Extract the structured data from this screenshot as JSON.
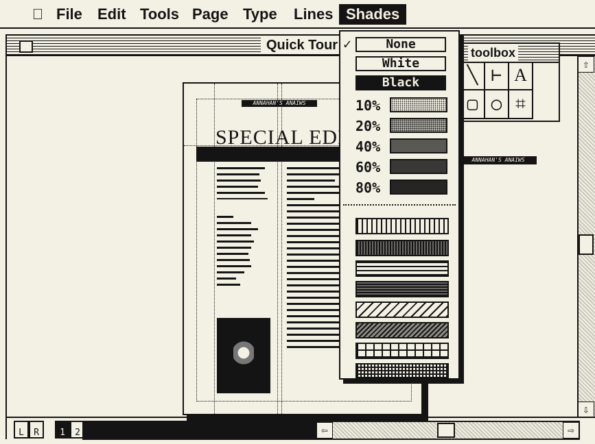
{
  "menubar": {
    "apple": "",
    "items": [
      "File",
      "Edit",
      "Tools",
      "Page",
      "Type",
      "Lines",
      "Shades"
    ]
  },
  "window": {
    "title": "Quick Tour"
  },
  "document": {
    "masthead": "ANNAHAN'S ANAIWS",
    "title": "SPECIAL EDIT",
    "side_strip": "ANNAHAN'S ANAIWS"
  },
  "toolbox": {
    "title": "toolbox",
    "tools": [
      "╲",
      "⊢",
      "A",
      "▢",
      "○",
      "⌗"
    ]
  },
  "shades_menu": {
    "check": "✓",
    "solid_items": [
      "None",
      "White",
      "Black"
    ],
    "percent_items": [
      "10%",
      "20%",
      "40%",
      "60%",
      "80%"
    ],
    "percent_values": [
      0.1,
      0.2,
      0.4,
      0.6,
      0.8
    ],
    "selected": "None"
  },
  "bottombar": {
    "page_icons": [
      "L",
      "R",
      "1",
      "2"
    ],
    "current_page": "1"
  },
  "colors": {
    "ink": "#141414",
    "paper": "#f3f0e4"
  }
}
